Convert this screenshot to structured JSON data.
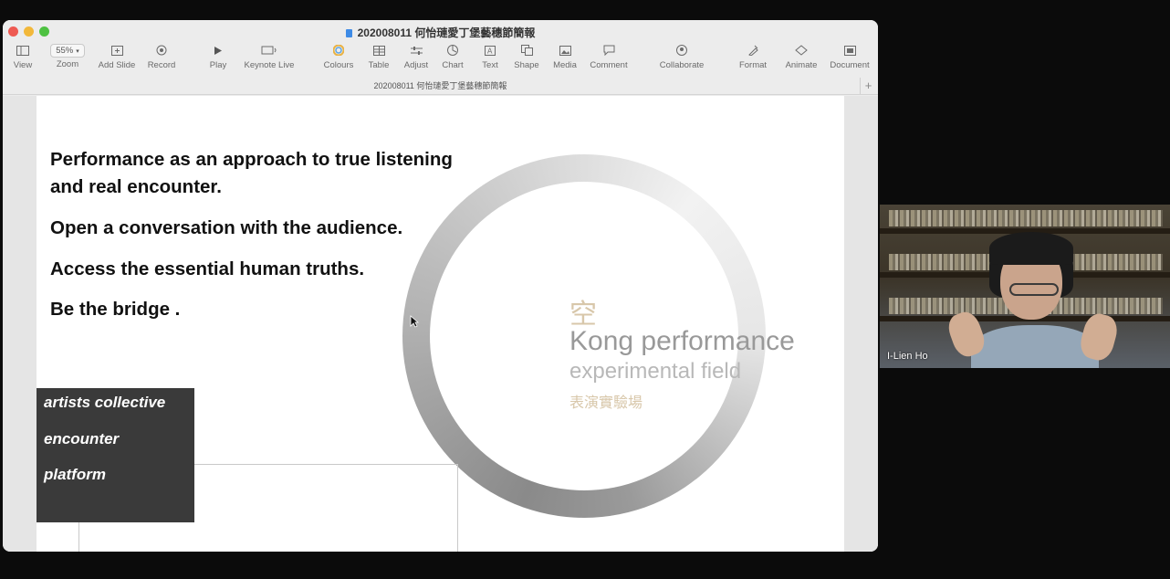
{
  "window": {
    "title": "202008011 何怡璉愛丁堡藝穗節簡報",
    "doc_tab": "202008011 何怡璉愛丁堡藝穗節簡報",
    "add_tab": "+"
  },
  "toolbar": {
    "view": "View",
    "zoom_value": "55%",
    "zoom": "Zoom",
    "add_slide": "Add Slide",
    "record": "Record",
    "play": "Play",
    "keynote_live": "Keynote Live",
    "colours": "Colours",
    "table": "Table",
    "adjust": "Adjust",
    "chart": "Chart",
    "text": "Text",
    "shape": "Shape",
    "media": "Media",
    "comment": "Comment",
    "collaborate": "Collaborate",
    "format": "Format",
    "animate": "Animate",
    "document": "Document"
  },
  "slide": {
    "lines": [
      "Performance as an approach to true listening",
      "and real encounter.",
      "Open a conversation with the audience.",
      "Access the essential human truths.",
      "Be the bridge ."
    ],
    "kong_cjk": "空",
    "kong_title": "Kong performance",
    "kong_sub": "experimental field",
    "kong_sub_cjk": "表演實驗場",
    "dark_items": [
      "artists collective",
      "encounter",
      "platform"
    ]
  },
  "video": {
    "participant_name": "I-Lien Ho"
  },
  "icons": {
    "view": "view-icon",
    "add_slide": "add-slide-icon",
    "record": "record-icon",
    "play": "play-icon",
    "keynote_live": "keynote-live-icon",
    "colours": "colours-icon",
    "table": "table-icon",
    "adjust": "adjust-icon",
    "chart": "chart-icon",
    "text": "text-icon",
    "shape": "shape-icon",
    "media": "media-icon",
    "comment": "comment-icon",
    "collaborate": "collaborate-icon",
    "format": "format-icon",
    "animate": "animate-icon",
    "document": "document-icon"
  },
  "colors": {
    "accent_beige": "#d8c7aa",
    "dark_box": "#3a3a3a",
    "light_red": "#ee5a52",
    "light_yellow": "#f2b83a",
    "light_green": "#4ec142"
  }
}
